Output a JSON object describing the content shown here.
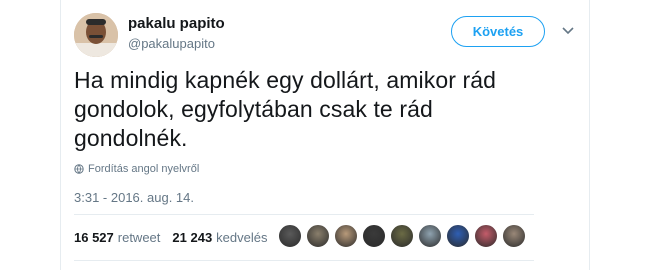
{
  "user": {
    "name": "pakalu papito",
    "handle": "@pakalupapito"
  },
  "follow_label": "Követés",
  "tweet_text": "Ha mindig kapnék egy dollárt, amikor rád gondolok, egyfolytában csak te rád gondolnék.",
  "translate_label": "Fordítás angol nyelvről",
  "timestamp": "3:31 - 2016. aug. 14.",
  "stats": {
    "retweets": "16 527",
    "retweets_label": "retweet",
    "likes": "21 243",
    "likes_label": "kedvelés"
  },
  "colors": {
    "accent": "#1da1f2",
    "secondary_text": "#657786",
    "divider": "#e6ecf0"
  },
  "likers": [
    "#5a5a5a",
    "#8a7f6c",
    "#b89a7a",
    "#3a3a3a",
    "#6b6b45",
    "#8fa3b0",
    "#2f5fb4",
    "#c45c6a",
    "#9a8878"
  ]
}
